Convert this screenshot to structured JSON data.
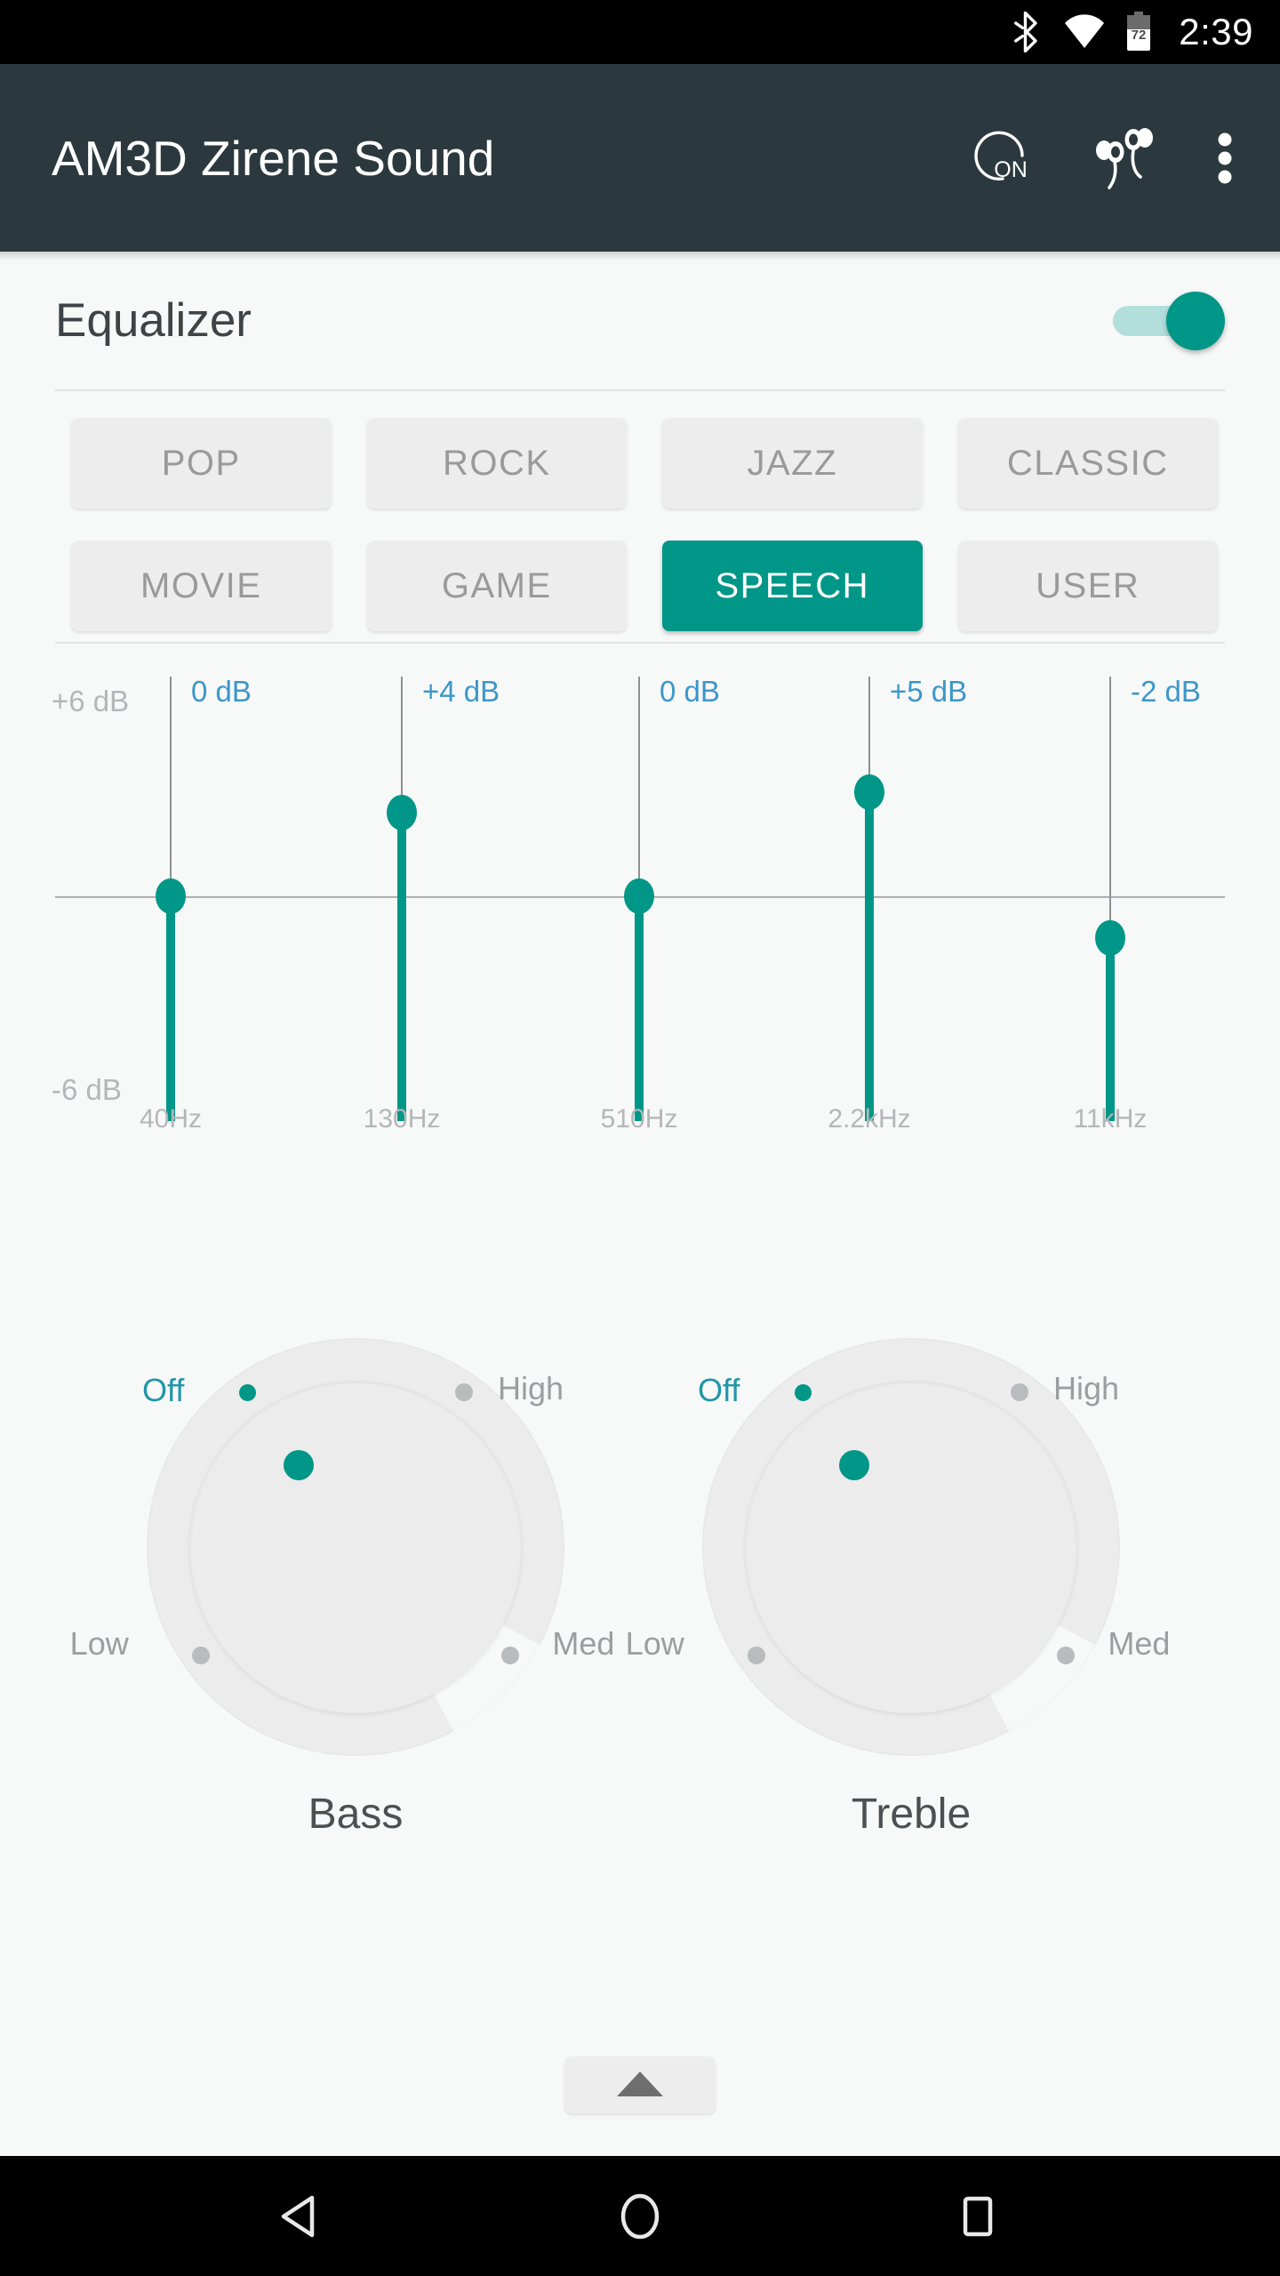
{
  "status_bar": {
    "time": "2:39",
    "battery_percent": "72",
    "icons": [
      "bluetooth-icon",
      "wifi-icon",
      "battery-icon"
    ]
  },
  "app_bar": {
    "title": "AM3D Zirene Sound",
    "actions": [
      {
        "name": "power-on-toggle",
        "label": "ON"
      },
      {
        "name": "earbuds-icon",
        "label": ""
      },
      {
        "name": "overflow-menu-icon",
        "label": ""
      }
    ]
  },
  "equalizer": {
    "label": "Equalizer",
    "enabled": true,
    "accent_color": "#009688",
    "track_color": "#b2dfdb"
  },
  "presets": {
    "selected": "SPEECH",
    "items": [
      {
        "label": "POP",
        "active": false
      },
      {
        "label": "ROCK",
        "active": false
      },
      {
        "label": "JAZZ",
        "active": false
      },
      {
        "label": "CLASSIC",
        "active": false
      },
      {
        "label": "MOVIE",
        "active": false
      },
      {
        "label": "GAME",
        "active": false
      },
      {
        "label": "SPEECH",
        "active": true
      },
      {
        "label": "USER",
        "active": false
      }
    ]
  },
  "chart_data": {
    "type": "bar",
    "title": "",
    "xlabel": "",
    "ylabel": "dB",
    "axis_top_label": "+6 dB",
    "axis_bottom_label": "-6 dB",
    "ylim": [
      -6,
      6
    ],
    "zero_line": true,
    "grid": false,
    "categories": [
      "40Hz",
      "130Hz",
      "510Hz",
      "2.2kHz",
      "11kHz"
    ],
    "values": [
      0,
      4,
      0,
      5,
      -2
    ],
    "value_labels": [
      "0 dB",
      "+4 dB",
      "0 dB",
      "+5 dB",
      "-2 dB"
    ],
    "bar_color": "#009688",
    "label_color": "#3d97c9",
    "tick_color": "#b4b7b8"
  },
  "knobs": [
    {
      "name": "Bass",
      "value": "Off",
      "ticks": [
        {
          "label": "Low",
          "active": false
        },
        {
          "label": "Med",
          "active": false
        },
        {
          "label": "Off",
          "active": true
        },
        {
          "label": "High",
          "active": false
        }
      ]
    },
    {
      "name": "Treble",
      "value": "Off",
      "ticks": [
        {
          "label": "Low",
          "active": false
        },
        {
          "label": "Med",
          "active": false
        },
        {
          "label": "Off",
          "active": true
        },
        {
          "label": "High",
          "active": false
        }
      ]
    }
  ],
  "expander": {
    "name": "expand-handle",
    "icon": "triangle-up-icon"
  },
  "nav_bar": {
    "buttons": [
      {
        "name": "nav-back",
        "icon": "triangle-left-icon"
      },
      {
        "name": "nav-home",
        "icon": "circle-icon"
      },
      {
        "name": "nav-recents",
        "icon": "square-icon"
      }
    ]
  }
}
